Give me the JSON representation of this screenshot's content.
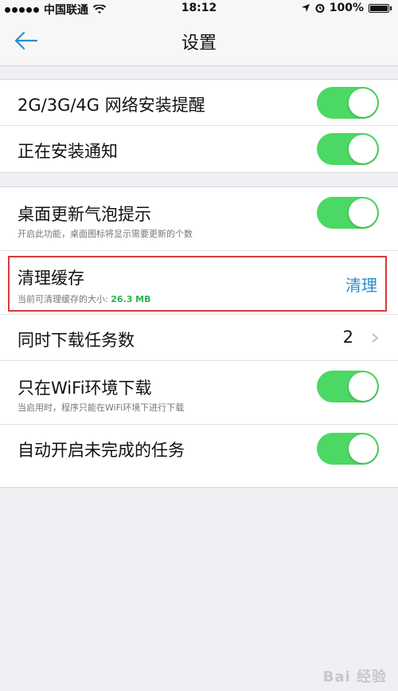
{
  "statusbar": {
    "carrier": "中国联通",
    "time": "18:12",
    "battery": "100%"
  },
  "navbar": {
    "title": "设置"
  },
  "settings": {
    "network_reminder": {
      "label": "2G/3G/4G 网络安装提醒",
      "enabled": true
    },
    "install_notify": {
      "label": "正在安装通知",
      "enabled": true
    },
    "desktop_bubble": {
      "label": "桌面更新气泡提示",
      "subtitle": "开启此功能，桌面图标将显示需要更新的个数",
      "enabled": true
    },
    "clear_cache": {
      "label": "清理缓存",
      "subtitle_prefix": "当前可清理缓存的大小: ",
      "size": "26.3 MB",
      "action": "清理"
    },
    "concurrent_downloads": {
      "label": "同时下载任务数",
      "value": "2"
    },
    "wifi_only": {
      "label": "只在WiFi环境下载",
      "subtitle": "当启用时，程序只能在WiFi环境下进行下载",
      "enabled": true
    },
    "auto_resume": {
      "label": "自动开启未完成的任务",
      "enabled": true
    }
  },
  "watermark": "Bai 经验",
  "colors": {
    "toggle_on": "#4cd864",
    "accent_blue": "#2c8ecf",
    "highlight_red": "#d43b3b",
    "size_green": "#2ab34f"
  }
}
